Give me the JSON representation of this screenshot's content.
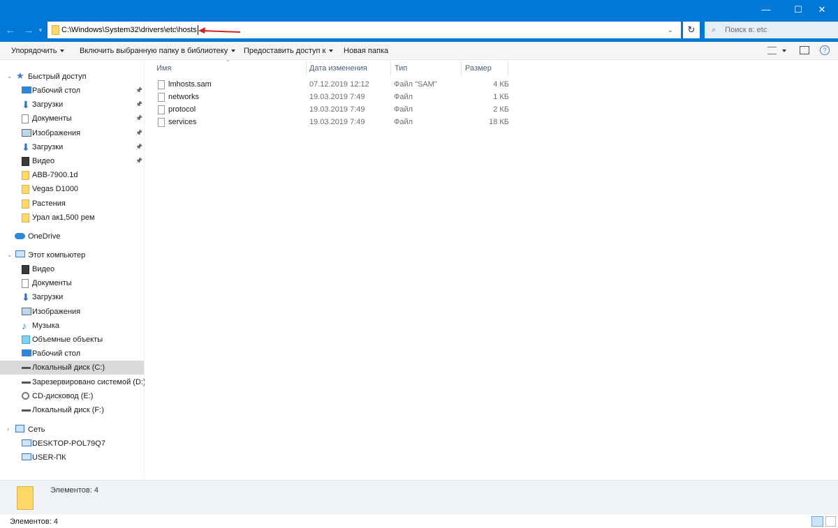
{
  "window": {
    "controls": [
      "—",
      "☐",
      "✕"
    ]
  },
  "address": {
    "path": "C:\\Windows\\System32\\drivers\\etc\\hosts",
    "search_placeholder": "Поиск в: etc"
  },
  "toolbar": {
    "organize": "Упорядочить",
    "library": "Включить выбранную папку в библиотеку",
    "share": "Предоставить доступ к",
    "new_folder": "Новая папка"
  },
  "sidebar": {
    "quick_access": "Быстрый доступ",
    "quick_items": [
      {
        "label": "Рабочий стол",
        "icon": "desktop-icon",
        "pinned": true
      },
      {
        "label": "Загрузки",
        "icon": "download-icon",
        "pinned": true
      },
      {
        "label": "Документы",
        "icon": "documents-icon",
        "pinned": true
      },
      {
        "label": "Изображения",
        "icon": "pictures-icon",
        "pinned": true
      },
      {
        "label": "Загрузки",
        "icon": "download-icon",
        "pinned": true
      },
      {
        "label": "Видео",
        "icon": "video-icon",
        "pinned": true
      },
      {
        "label": "ABB-7900.1d",
        "icon": "folder-icon",
        "pinned": false
      },
      {
        "label": "Vegas D1000",
        "icon": "folder-icon",
        "pinned": false
      },
      {
        "label": "Растения",
        "icon": "folder-icon",
        "pinned": false
      },
      {
        "label": "Урал ак1,500 рем",
        "icon": "folder-icon",
        "pinned": false
      }
    ],
    "onedrive": "OneDrive",
    "this_pc": "Этот компьютер",
    "pc_items": [
      {
        "label": "Видео",
        "icon": "video-icon"
      },
      {
        "label": "Документы",
        "icon": "documents-icon"
      },
      {
        "label": "Загрузки",
        "icon": "download-icon"
      },
      {
        "label": "Изображения",
        "icon": "pictures-icon"
      },
      {
        "label": "Музыка",
        "icon": "music-icon"
      },
      {
        "label": "Объемные объекты",
        "icon": "3d-objects-icon"
      },
      {
        "label": "Рабочий стол",
        "icon": "desktop-icon"
      },
      {
        "label": "Локальный диск (C:)",
        "icon": "drive-icon",
        "selected": true
      },
      {
        "label": "Зарезервировано системой (D:)",
        "icon": "drive-icon"
      },
      {
        "label": "CD-дисковод (E:)",
        "icon": "cd-drive-icon"
      },
      {
        "label": "Локальный диск (F:)",
        "icon": "drive-icon"
      }
    ],
    "network": "Сеть",
    "network_items": [
      {
        "label": "DESKTOP-POL79Q7",
        "icon": "computer-icon"
      },
      {
        "label": "USER-ПК",
        "icon": "computer-icon"
      }
    ]
  },
  "columns": {
    "name": "Имя",
    "modified": "Дата изменения",
    "type": "Тип",
    "size": "Размер"
  },
  "files": [
    {
      "name": "lmhosts.sam",
      "modified": "07.12.2019 12:12",
      "type": "Файл \"SAM\"",
      "size": "4 КБ"
    },
    {
      "name": "networks",
      "modified": "19.03.2019 7:49",
      "type": "Файл",
      "size": "1 КБ"
    },
    {
      "name": "protocol",
      "modified": "19.03.2019 7:49",
      "type": "Файл",
      "size": "2 КБ"
    },
    {
      "name": "services",
      "modified": "19.03.2019 7:49",
      "type": "Файл",
      "size": "18 КБ"
    }
  ],
  "details_pane": {
    "count": "Элементов: 4"
  },
  "status": {
    "count": "Элементов: 4"
  },
  "colors": {
    "accent": "#0078d7",
    "selection": "#d9d9d9",
    "folder": "#ffd869"
  }
}
